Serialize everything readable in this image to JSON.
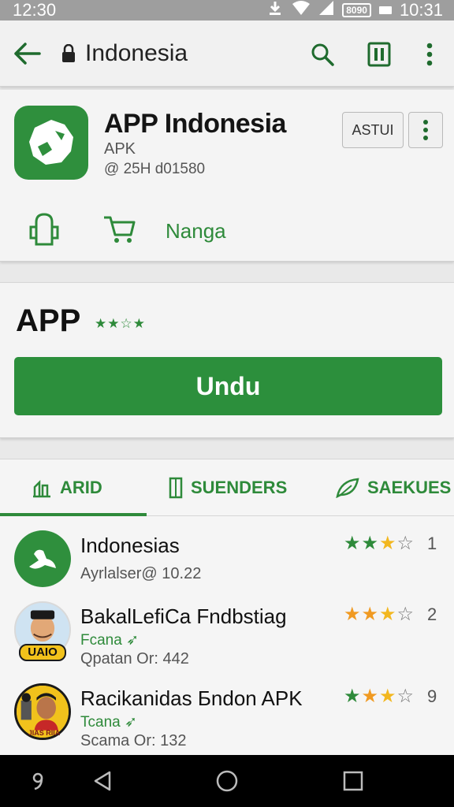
{
  "status_bar": {
    "time_left": "12:30",
    "time_right": "10:31",
    "badge": "8090"
  },
  "toolbar": {
    "title": "Indonesia"
  },
  "app": {
    "name": "APP Indonesia",
    "type": "APK",
    "meta": "@ 25H d01580",
    "button_label": "ASTUI",
    "action_label": "Nanga"
  },
  "install": {
    "title": "APP",
    "stars": "★★☆★",
    "button_label": "Undu"
  },
  "tabs": [
    {
      "label": "ARID"
    },
    {
      "label": "SUENDERS"
    },
    {
      "label": "SAEKUES"
    }
  ],
  "list": [
    {
      "name": "Indonesias",
      "sub": "",
      "meta": "Ayrlalser@  10.22",
      "rating": "1"
    },
    {
      "name": "BakalLefiCa Fndbstiag",
      "sub": "Fcana",
      "meta": "Qpatan Or: 442",
      "rating": "2",
      "avatar_text": "UAIO"
    },
    {
      "name": "Racikanidas Бndon APK",
      "sub": "Tcana",
      "meta": "Scama Or: 132",
      "rating": "9",
      "avatar_text": "JIAS RIIA"
    }
  ],
  "colors": {
    "accent": "#2e8a3a",
    "star_yellow": "#f2b71f"
  }
}
